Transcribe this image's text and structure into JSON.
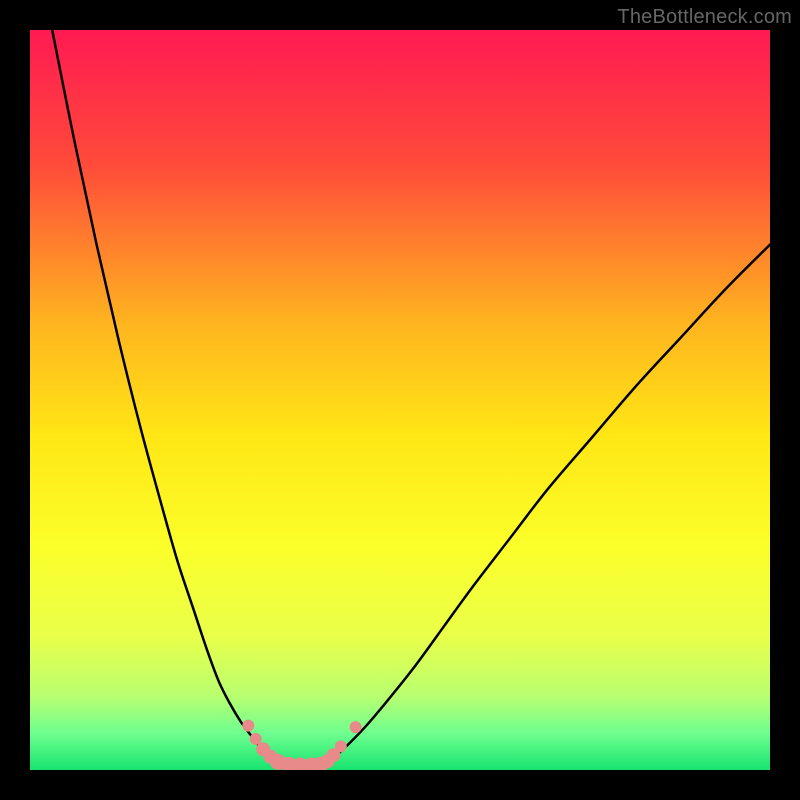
{
  "watermark": "TheBottleneck.com",
  "chart_data": {
    "type": "line",
    "title": "",
    "xlabel": "",
    "ylabel": "",
    "xlim": [
      0,
      100
    ],
    "ylim": [
      0,
      100
    ],
    "background_gradient": {
      "stops": [
        {
          "offset": 0.0,
          "color": "#ff1a52"
        },
        {
          "offset": 0.18,
          "color": "#ff4a3a"
        },
        {
          "offset": 0.4,
          "color": "#ffb61f"
        },
        {
          "offset": 0.55,
          "color": "#ffe715"
        },
        {
          "offset": 0.7,
          "color": "#fbff2a"
        },
        {
          "offset": 0.82,
          "color": "#e9ff4a"
        },
        {
          "offset": 0.9,
          "color": "#b8ff70"
        },
        {
          "offset": 0.95,
          "color": "#6fff8f"
        },
        {
          "offset": 1.0,
          "color": "#17e36f"
        }
      ]
    },
    "series": [
      {
        "name": "left-branch",
        "x": [
          3,
          6,
          9,
          12,
          15,
          18,
          20,
          22,
          24,
          25.5,
          27,
          28.5,
          30,
          31,
          32,
          33,
          34
        ],
        "y": [
          100,
          85,
          71,
          58,
          46,
          35,
          28,
          22,
          16,
          12,
          9,
          6.5,
          4.5,
          3.2,
          2.2,
          1.4,
          0.8
        ]
      },
      {
        "name": "right-branch",
        "x": [
          40,
          42,
          45,
          48,
          52,
          56,
          60,
          65,
          70,
          76,
          82,
          88,
          94,
          100
        ],
        "y": [
          0.8,
          2.5,
          5.5,
          9,
          14,
          19.5,
          25,
          31.5,
          38,
          45,
          52,
          58.5,
          65,
          71
        ]
      }
    ],
    "markers": {
      "name": "highlight-points",
      "color": "#e88a8a",
      "points": [
        {
          "x": 29.5,
          "y": 6.0,
          "r": 6
        },
        {
          "x": 30.5,
          "y": 4.2,
          "r": 6
        },
        {
          "x": 31.5,
          "y": 2.8,
          "r": 7
        },
        {
          "x": 32.5,
          "y": 1.8,
          "r": 7
        },
        {
          "x": 33.5,
          "y": 1.1,
          "r": 8
        },
        {
          "x": 35.0,
          "y": 0.7,
          "r": 8
        },
        {
          "x": 36.5,
          "y": 0.6,
          "r": 8
        },
        {
          "x": 38.0,
          "y": 0.6,
          "r": 8
        },
        {
          "x": 39.2,
          "y": 0.7,
          "r": 8
        },
        {
          "x": 40.2,
          "y": 1.2,
          "r": 7
        },
        {
          "x": 41.0,
          "y": 2.0,
          "r": 7
        },
        {
          "x": 42.0,
          "y": 3.2,
          "r": 6
        },
        {
          "x": 44.0,
          "y": 5.8,
          "r": 6
        }
      ]
    }
  }
}
